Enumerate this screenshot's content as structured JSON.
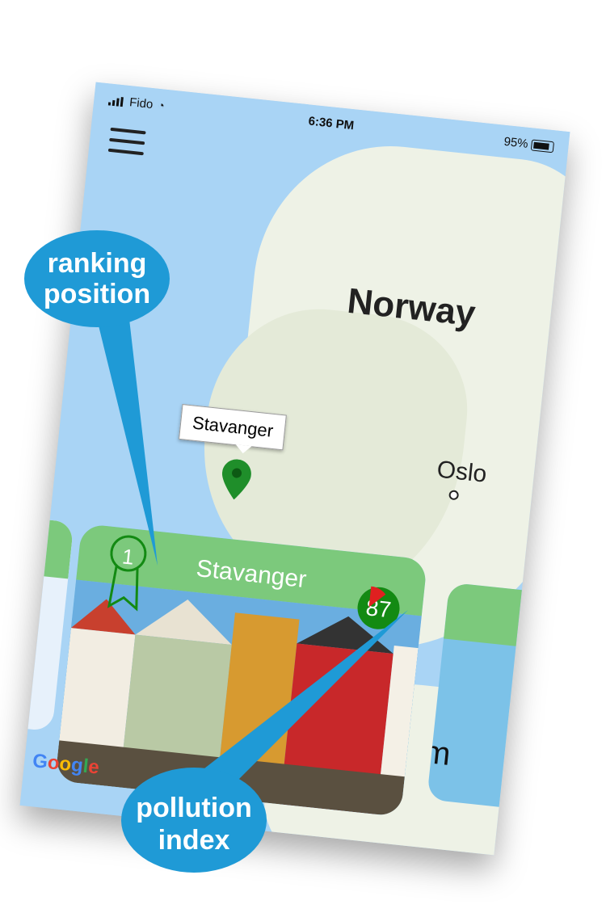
{
  "status_bar": {
    "carrier": "Fido",
    "time": "6:36 PM",
    "battery": "95%"
  },
  "map": {
    "country_label": "Norway",
    "city_label": "Oslo",
    "marker_callout": "Stavanger",
    "google_letters": [
      "G",
      "o",
      "o",
      "g",
      "l",
      "e"
    ]
  },
  "card": {
    "rank": "1",
    "city": "Stavanger",
    "pollution_index": "87",
    "pollution_fraction": 0.13
  },
  "side_card_right": {
    "text": "m"
  },
  "annotations": {
    "ranking": [
      "ranking",
      "position"
    ],
    "pollution": [
      "pollution",
      "index"
    ]
  },
  "colors": {
    "accent": "#1f9ad6",
    "score_green": "#138a13",
    "header_green": "#7cc97c",
    "wedge_red": "#e02020"
  }
}
